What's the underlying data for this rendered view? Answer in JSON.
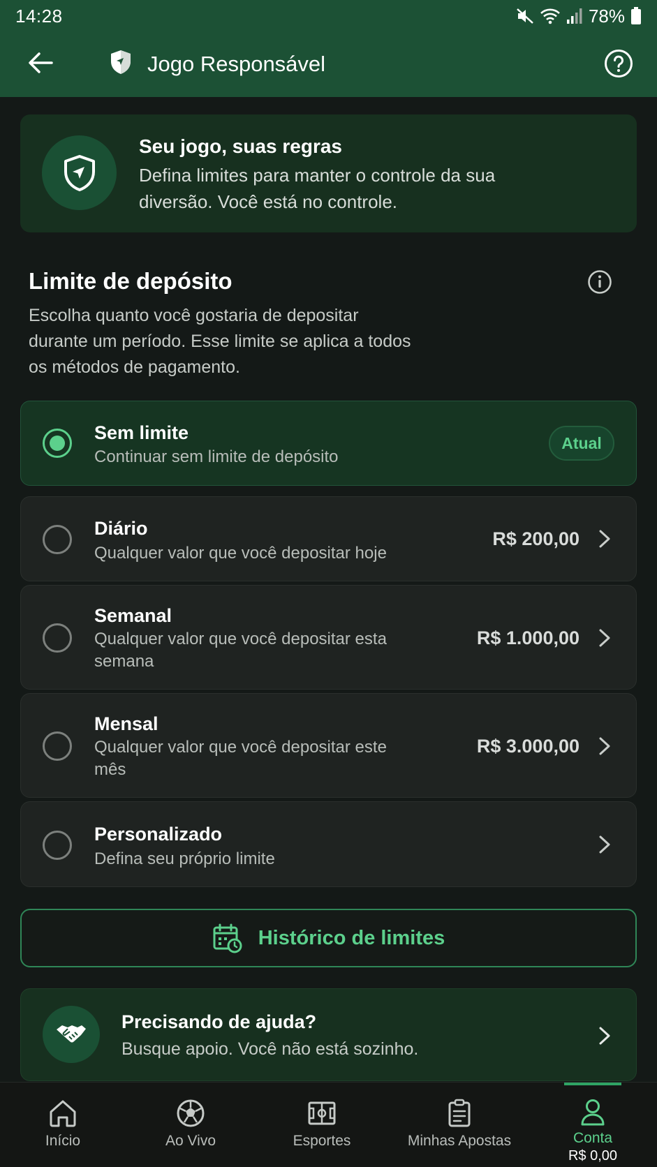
{
  "status_bar": {
    "time": "14:28",
    "battery": "78%"
  },
  "app_bar": {
    "title": "Jogo Responsável"
  },
  "hero": {
    "title": "Seu jogo, suas regras",
    "description": "Defina limites para manter o controle da sua diversão. Você está no controle."
  },
  "deposit_limit": {
    "title": "Limite de depósito",
    "description": "Escolha quanto você gostaria de depositar durante um período. Esse limite se aplica a todos os métodos de pagamento.",
    "options": [
      {
        "title": "Sem limite",
        "subtitle": "Continuar sem limite de depósito",
        "amount": "",
        "badge": "Atual",
        "selected": true
      },
      {
        "title": "Diário",
        "subtitle": "Qualquer valor que você depositar hoje",
        "amount": "R$ 200,00",
        "selected": false
      },
      {
        "title": "Semanal",
        "subtitle": "Qualquer valor que você depositar esta semana",
        "amount": "R$ 1.000,00",
        "selected": false
      },
      {
        "title": "Mensal",
        "subtitle": "Qualquer valor que você depositar este mês",
        "amount": "R$ 3.000,00",
        "selected": false
      },
      {
        "title": "Personalizado",
        "subtitle": "Defina seu próprio limite",
        "amount": "",
        "selected": false
      }
    ]
  },
  "history_button": {
    "label": "Histórico de limites"
  },
  "help_card": {
    "title": "Precisando de ajuda?",
    "subtitle": "Busque apoio. Você não está sozinho."
  },
  "bottom_nav": {
    "items": [
      {
        "label": "Início",
        "icon": "home-icon"
      },
      {
        "label": "Ao Vivo",
        "icon": "soccer-ball-icon"
      },
      {
        "label": "Esportes",
        "icon": "field-icon"
      },
      {
        "label": "Minhas Apostas",
        "icon": "clipboard-icon"
      },
      {
        "label": "Conta",
        "icon": "user-icon",
        "active": true,
        "balance": "R$ 0,00"
      }
    ]
  },
  "colors": {
    "accent": "#5cd08c",
    "header": "#1c5135",
    "background": "#141917",
    "card": "#1f2321",
    "card_selected": "#163522"
  }
}
